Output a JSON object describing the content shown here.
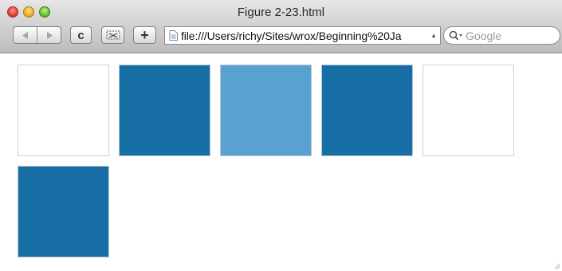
{
  "window": {
    "title": "Figure 2-23.html"
  },
  "toolbar": {
    "back_icon": "back-arrow-icon",
    "forward_icon": "forward-arrow-icon",
    "reload_icon": "reload-icon",
    "reload_glyph": "c",
    "snapback_icon": "snapback-icon",
    "add_bookmark_glyph": "+",
    "url": "file:///Users/richy/Sites/wrox/Beginning%20Ja",
    "search_placeholder": "Google"
  },
  "squares": [
    {
      "row": 1,
      "col": 1,
      "style": "outline",
      "color": "#ffffff"
    },
    {
      "row": 1,
      "col": 2,
      "style": "filled",
      "color": "#166ea4"
    },
    {
      "row": 1,
      "col": 3,
      "style": "filled",
      "color": "#58a1d0"
    },
    {
      "row": 1,
      "col": 4,
      "style": "filled",
      "color": "#166ea4"
    },
    {
      "row": 1,
      "col": 5,
      "style": "outline",
      "color": "#ffffff"
    },
    {
      "row": 2,
      "col": 1,
      "style": "filled",
      "color": "#166ea4"
    }
  ]
}
